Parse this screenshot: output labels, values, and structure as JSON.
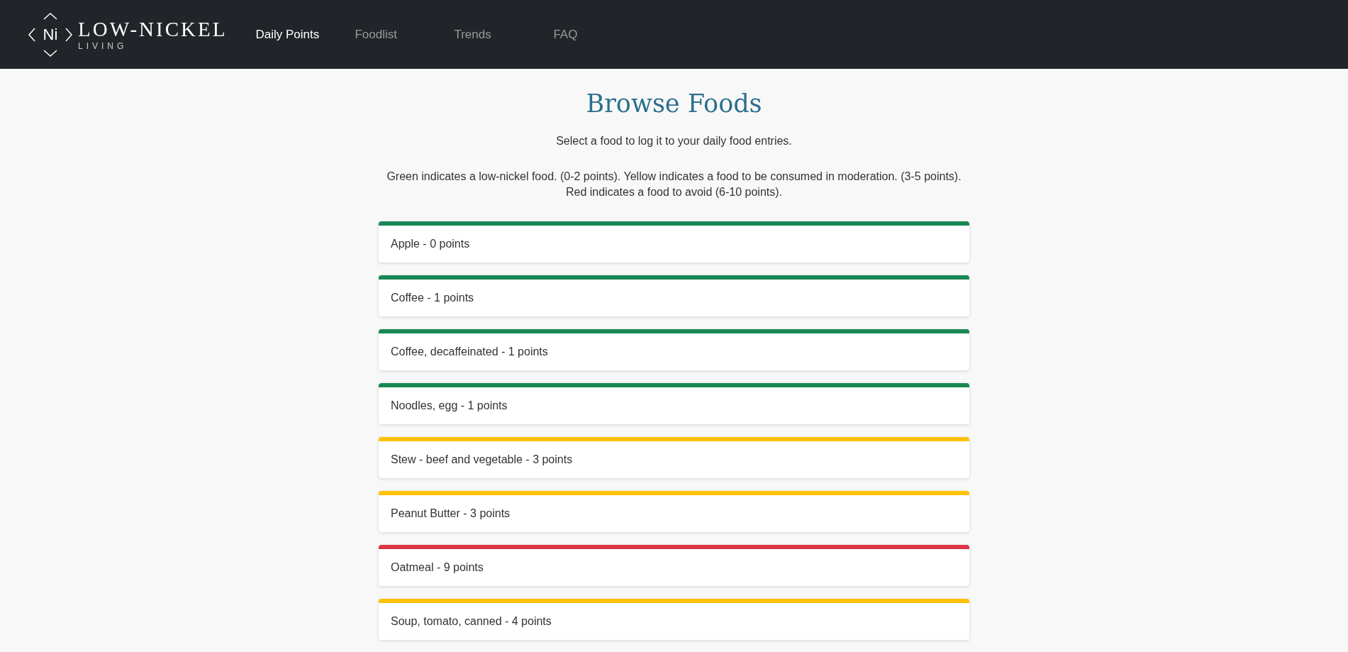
{
  "logo": {
    "mark": "Ni",
    "name": "LOW-NICKEL",
    "tagline": "LIVING"
  },
  "nav": [
    {
      "label": "Daily Points",
      "selected": true
    },
    {
      "label": "Foodlist",
      "selected": false
    },
    {
      "label": "Trends",
      "selected": false
    },
    {
      "label": "FAQ",
      "selected": false
    }
  ],
  "title": "Browse Foods",
  "intro": "Select a food to log it to your daily food entries.",
  "legend": [
    "Green indicates a low-nickel food. (0-2 points). Yellow indicates a food to be consumed in moderation. (3-5 points).",
    "Red indicates a food to avoid (6-10 points)."
  ],
  "foods": [
    {
      "label": "Apple - 0 points",
      "color": "#198754"
    },
    {
      "label": "Coffee - 1 points",
      "color": "#198754"
    },
    {
      "label": "Coffee, decaffeinated - 1 points",
      "color": "#198754"
    },
    {
      "label": "Noodles, egg - 1 points",
      "color": "#198754"
    },
    {
      "label": "Stew - beef and vegetable - 3 points",
      "color": "#ffc107"
    },
    {
      "label": "Peanut Butter - 3 points",
      "color": "#ffc107"
    },
    {
      "label": "Oatmeal - 9 points",
      "color": "#dc3545"
    },
    {
      "label": "Soup, tomato, canned - 4 points",
      "color": "#ffc107"
    }
  ]
}
